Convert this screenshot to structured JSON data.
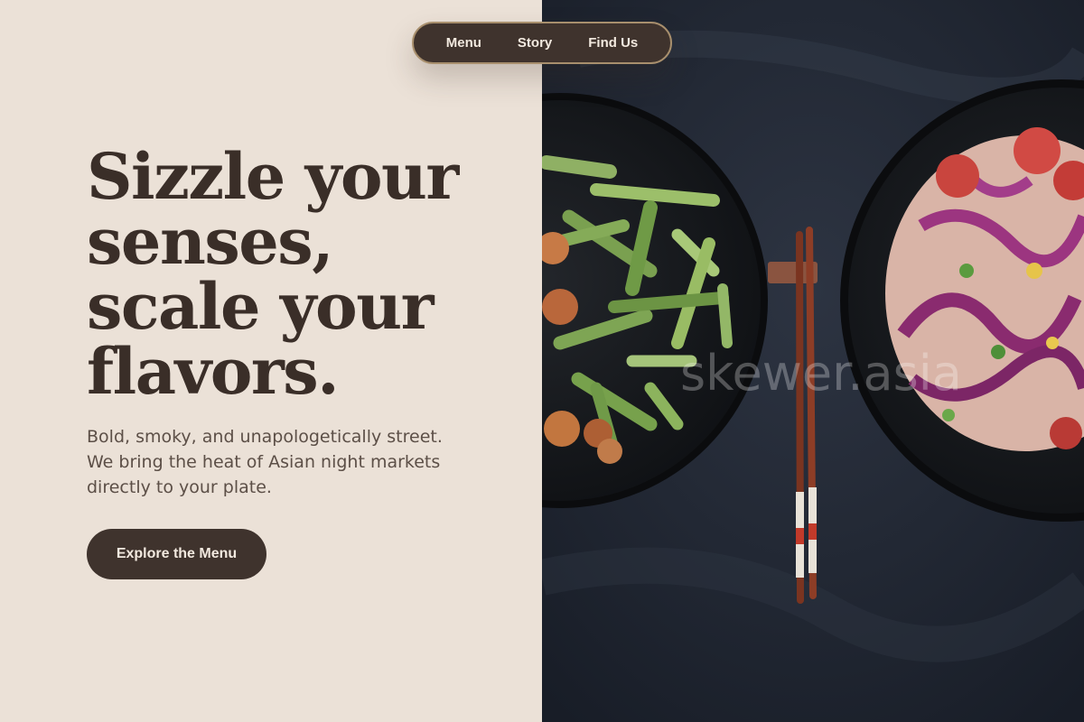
{
  "nav": {
    "items": [
      {
        "label": "Menu"
      },
      {
        "label": "Story"
      },
      {
        "label": "Find Us"
      }
    ]
  },
  "hero": {
    "headline_lines": [
      "Sizzle your",
      "senses,",
      "scale your",
      "flavors."
    ],
    "subtext_lines": [
      "Bold, smoky, and unapologetically street.",
      "We bring the heat of Asian night markets",
      "directly to your plate."
    ],
    "cta_label": "Explore the Menu"
  },
  "image": {
    "watermark": "skewer.asia",
    "description_icon": "food-bowls-photo"
  },
  "colors": {
    "background": "#ebe1d7",
    "dark": "#3f332d",
    "text": "#3a2e28",
    "accent_border": "#a88f6d"
  }
}
